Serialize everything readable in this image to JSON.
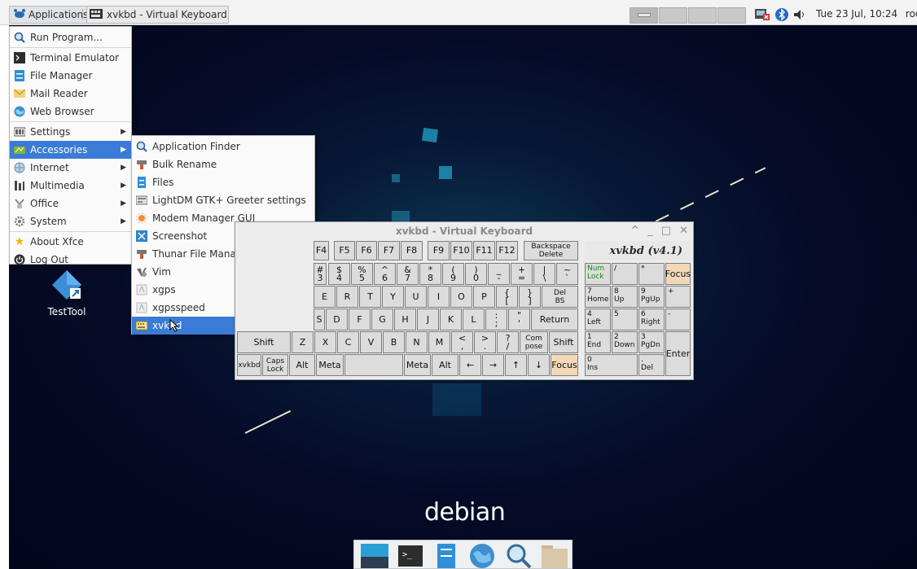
{
  "panel": {
    "applications_label": "Applications",
    "task_title": "xvkbd - Virtual Keyboard",
    "clock": "Tue 23 Jul, 10:24",
    "user": "root"
  },
  "main_menu": {
    "items": [
      {
        "label": "Run Program...",
        "icon": "search-icon"
      },
      {
        "label": "Terminal Emulator",
        "icon": "terminal-icon"
      },
      {
        "label": "File Manager",
        "icon": "file-manager-icon"
      },
      {
        "label": "Mail Reader",
        "icon": "mail-icon"
      },
      {
        "label": "Web Browser",
        "icon": "globe-icon"
      },
      {
        "label": "Settings",
        "icon": "settings-icon"
      },
      {
        "label": "Accessories",
        "icon": "accessories-icon"
      },
      {
        "label": "Internet",
        "icon": "internet-icon"
      },
      {
        "label": "Multimedia",
        "icon": "multimedia-icon"
      },
      {
        "label": "Office",
        "icon": "office-icon"
      },
      {
        "label": "System",
        "icon": "system-icon"
      },
      {
        "label": "About Xfce",
        "icon": "star-icon"
      },
      {
        "label": "Log Out",
        "icon": "logout-icon"
      }
    ]
  },
  "accessories_menu": {
    "items": [
      {
        "label": "Application Finder",
        "icon": "search-icon"
      },
      {
        "label": "Bulk Rename",
        "icon": "rename-icon"
      },
      {
        "label": "Files",
        "icon": "files-icon"
      },
      {
        "label": "LightDM GTK+ Greeter settings",
        "icon": "greeter-icon"
      },
      {
        "label": "Modem Manager GUI",
        "icon": "modem-icon"
      },
      {
        "label": "Screenshot",
        "icon": "screenshot-icon"
      },
      {
        "label": "Thunar File Manager",
        "icon": "thunar-icon"
      },
      {
        "label": "Vim",
        "icon": "vim-icon"
      },
      {
        "label": "xgps",
        "icon": "xgps-icon"
      },
      {
        "label": "xgpsspeed",
        "icon": "xgpsspeed-icon"
      },
      {
        "label": "xvkbd",
        "icon": "xvkbd-icon"
      }
    ]
  },
  "desktop": {
    "icon_label": "TestTool",
    "wallpaper_text": "debian"
  },
  "keyboard": {
    "title": "xvkbd - Virtual Keyboard",
    "banner": "xvkbd (v4.1)",
    "window_buttons": [
      "^",
      "_",
      "□",
      "✕"
    ]
  },
  "colors": {
    "selection": "#3a7bd5",
    "focus_key": "#f3d8b8",
    "desktop_bg": "#050a26"
  }
}
